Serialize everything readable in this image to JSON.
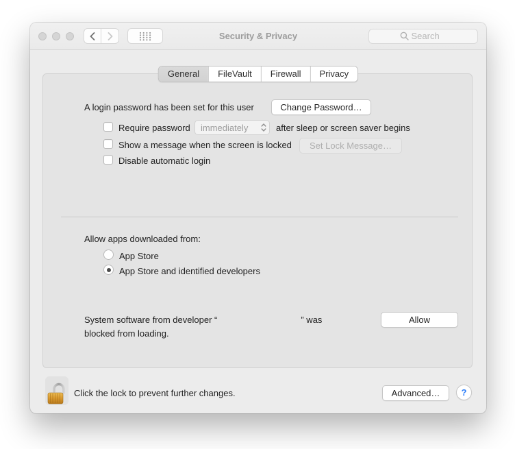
{
  "window": {
    "title": "Security & Privacy"
  },
  "toolbar": {
    "search_placeholder": "Search"
  },
  "tabs": [
    {
      "label": "General"
    },
    {
      "label": "FileVault"
    },
    {
      "label": "Firewall"
    },
    {
      "label": "Privacy"
    }
  ],
  "general": {
    "login_password_text": "A login password has been set for this user",
    "change_password_label": "Change Password…",
    "require_password_label": "Require password",
    "require_password_value": "immediately",
    "require_password_suffix": "after sleep or screen saver begins",
    "show_message_label": "Show a message when the screen is locked",
    "set_lock_message_label": "Set Lock Message…",
    "disable_auto_login_label": "Disable automatic login",
    "allow_apps_label": "Allow apps downloaded from:",
    "radio_app_store_label": "App Store",
    "radio_identified_label": "App Store and identified developers",
    "system_software_before": "System software from developer “",
    "system_software_after": "” was",
    "system_software_line2": "blocked from loading.",
    "allow_label": "Allow"
  },
  "footer": {
    "lock_text": "Click the lock to prevent further changes.",
    "advanced_label": "Advanced…",
    "help_label": "?"
  },
  "colors": {
    "help_accent": "#2d7ff9",
    "lock_gold": "#d9992e",
    "panel_bg": "#e4e4e4"
  }
}
